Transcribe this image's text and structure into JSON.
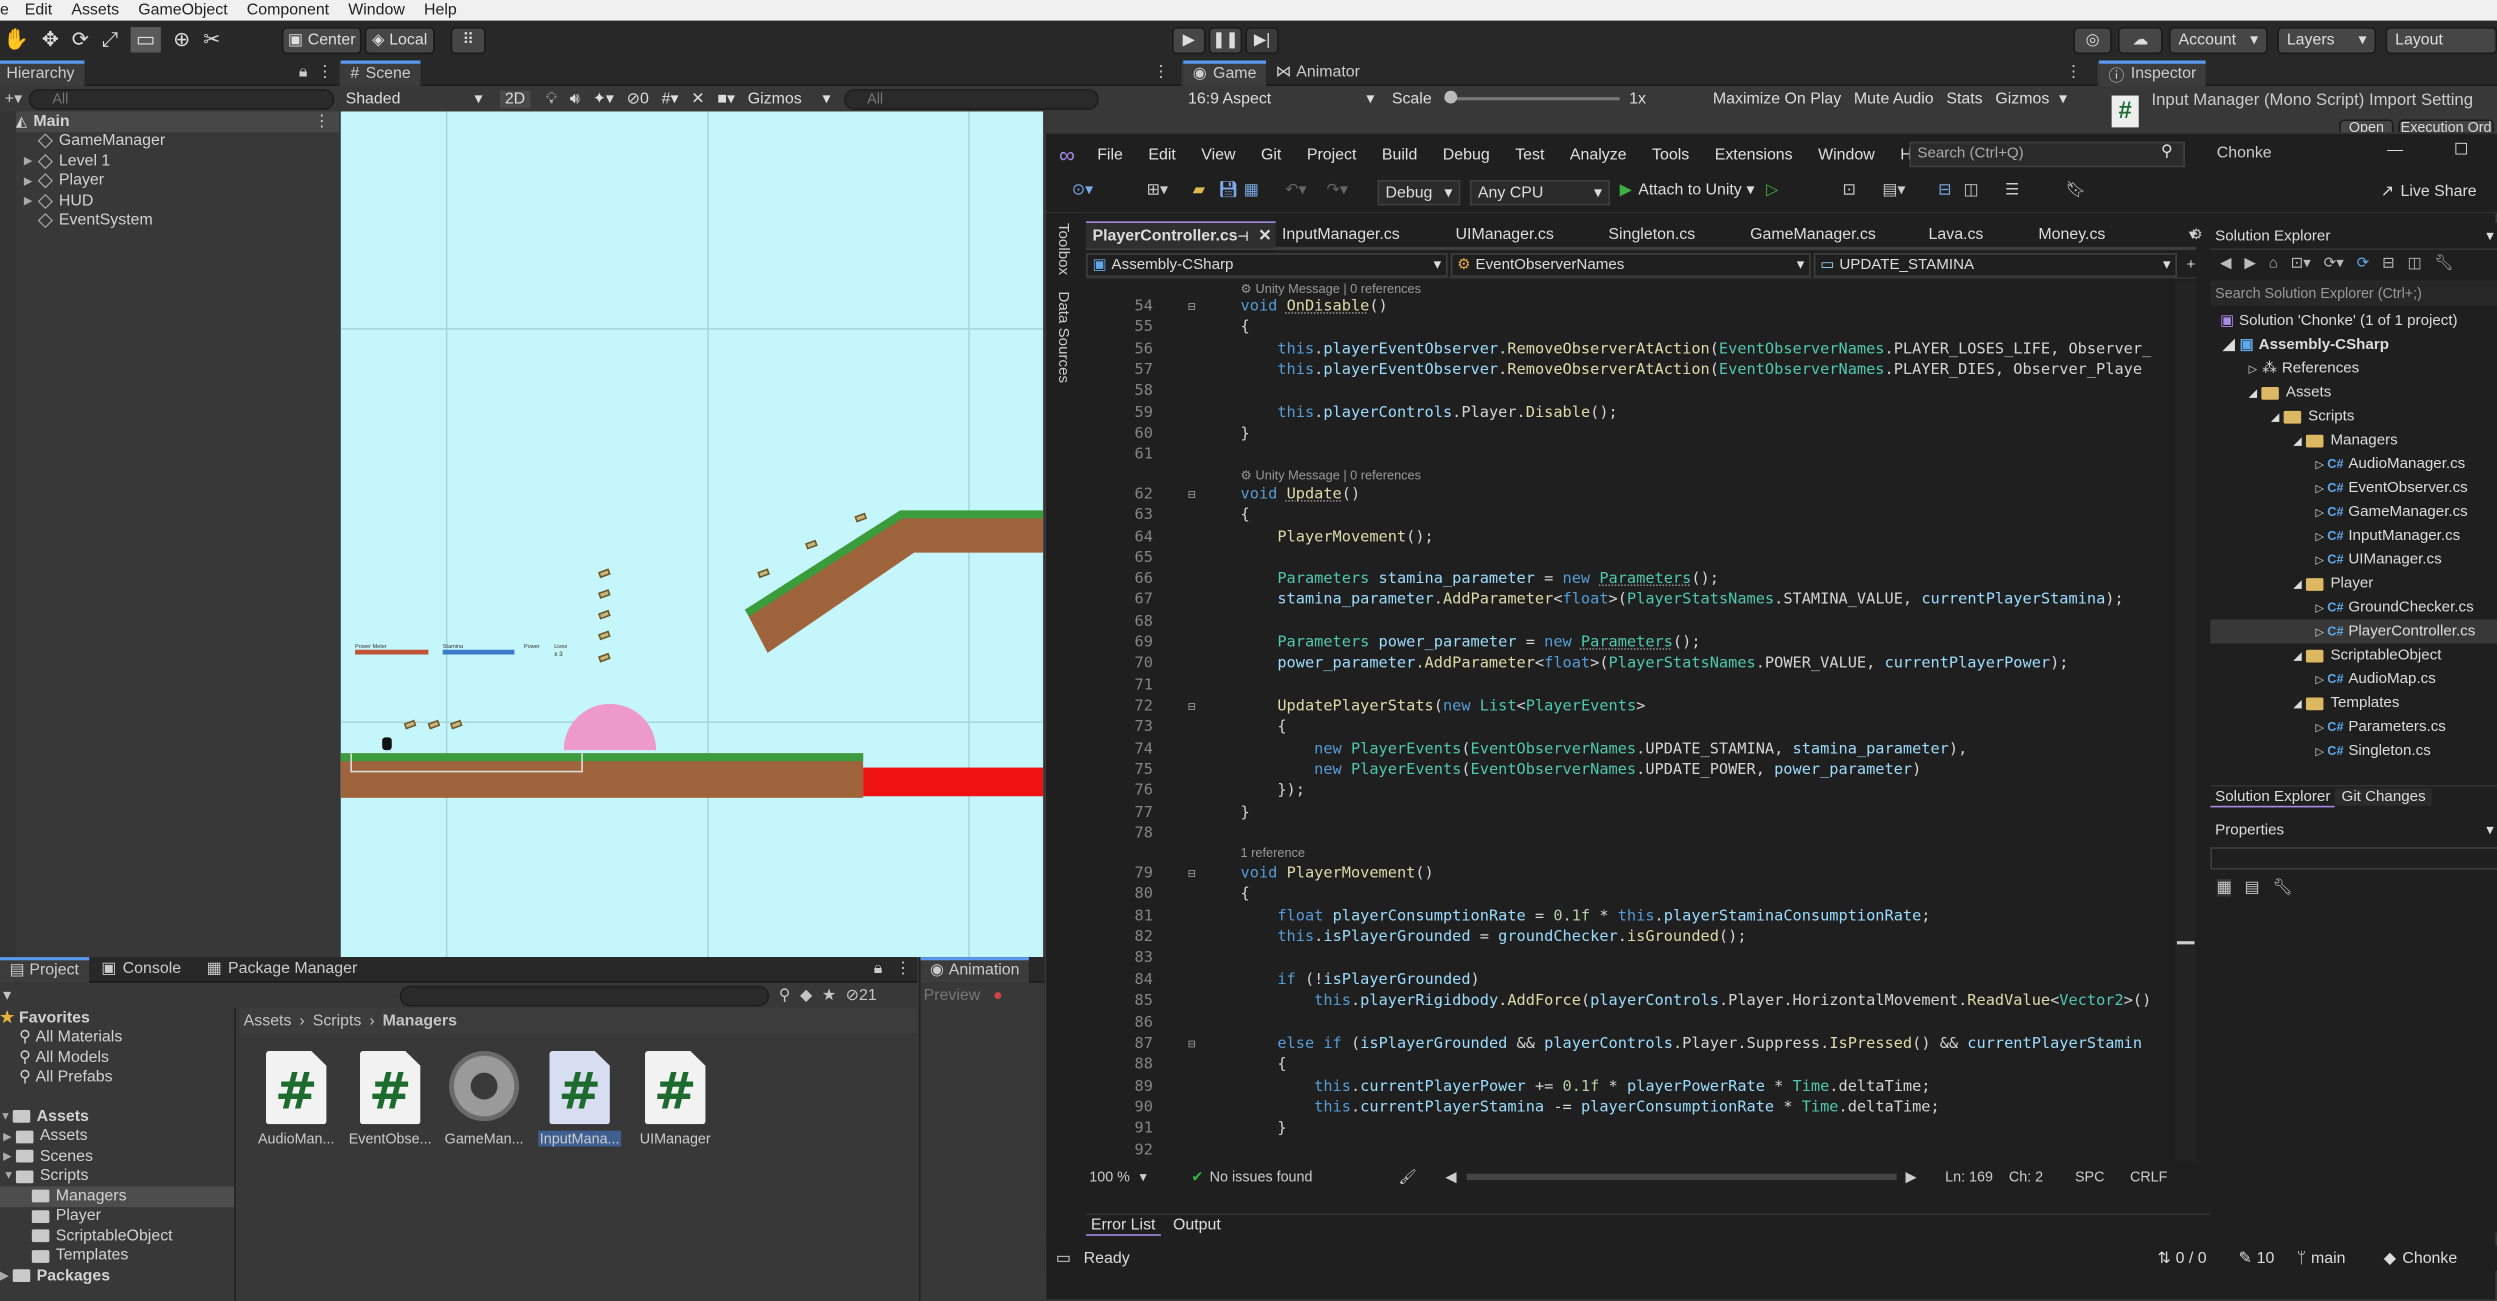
{
  "unity": {
    "menu": [
      "e",
      "Edit",
      "Assets",
      "GameObject",
      "Component",
      "Window",
      "Help"
    ],
    "toolbar": {
      "pivot": "Center",
      "space": "Local",
      "account": "Account",
      "layers": "Layers",
      "layout": "Layout"
    },
    "hierarchy": {
      "title": "Hierarchy",
      "search": "All",
      "scene": "Main",
      "items": [
        "GameManager",
        "Level 1",
        "Player",
        "HUD",
        "EventSystem"
      ]
    },
    "scene": {
      "title": "Scene",
      "shading": "Shaded",
      "mode2d": "2D",
      "hidden_count": "0",
      "gizmos": "Gizmos",
      "search": "All",
      "hud_labels": [
        "Power Meter",
        "Stamina",
        "Power",
        "Lives"
      ],
      "hud_lives": "x 3"
    },
    "game": {
      "title": "Game",
      "animator": "Animator",
      "aspect": "16:9 Aspect",
      "scale_label": "Scale",
      "scale_value": "1x",
      "buttons": [
        "Maximize On Play",
        "Mute Audio",
        "Stats",
        "Gizmos"
      ]
    },
    "inspector": {
      "title": "Inspector",
      "subject": "Input Manager (Mono Script) Import Setting",
      "btn_open": "Open",
      "btn_exec": "Execution Ord"
    },
    "bottom_tabs": [
      "Project",
      "Console",
      "Package Manager"
    ],
    "animation": {
      "title": "Animation",
      "preview": "Preview"
    },
    "hidden_packages": "21",
    "project_tree": {
      "favorites": "Favorites",
      "fav_items": [
        "All Materials",
        "All Models",
        "All Prefabs"
      ],
      "assets": "Assets",
      "asset_items": [
        "Assets",
        "Scenes",
        "Scripts"
      ],
      "script_items": [
        "Managers",
        "Player",
        "ScriptableObject",
        "Templates"
      ],
      "packages": "Packages"
    },
    "breadcrumb": [
      "Assets",
      "Scripts",
      "Managers"
    ],
    "assets": [
      {
        "name": "AudioMan...",
        "icon": "csharp-script-icon"
      },
      {
        "name": "EventObse...",
        "icon": "csharp-script-icon"
      },
      {
        "name": "GameMan...",
        "icon": "gear-icon"
      },
      {
        "name": "InputMana...",
        "icon": "csharp-script-icon"
      },
      {
        "name": "UIManager",
        "icon": "csharp-script-icon"
      }
    ]
  },
  "vs": {
    "menu": [
      "File",
      "Edit",
      "View",
      "Git",
      "Project",
      "Build",
      "Debug",
      "Test",
      "Analyze",
      "Tools",
      "Extensions",
      "Window",
      "Help"
    ],
    "search_placeholder": "Search (Ctrl+Q)",
    "config": "Debug",
    "platform": "Any CPU",
    "attach": "Attach to Unity",
    "live_share": "Live Share",
    "project_name": "Chonke",
    "side_tabs": [
      "Toolbox",
      "Data Sources"
    ],
    "tabs": [
      "PlayerController.cs",
      "InputManager.cs",
      "UIManager.cs",
      "Singleton.cs",
      "GameManager.cs",
      "Lava.cs",
      "Money.cs"
    ],
    "nav": {
      "project": "Assembly-CSharp",
      "class": "EventObserverNames",
      "member": "UPDATE_STAMINA"
    },
    "code_lens": {
      "unity_msg": "Unity Message | 0 references",
      "one_ref": "1 reference"
    },
    "status": {
      "zoom": "100 %",
      "issues": "No issues found",
      "line": "Ln: 169",
      "col": "Ch: 2",
      "spc": "SPC",
      "crlf": "CRLF"
    },
    "bottom_tabs": [
      "Error List",
      "Output"
    ],
    "statusbar": {
      "ready": "Ready",
      "changes": "0 / 0",
      "commits": "10",
      "branch": "main",
      "repo": "Chonke"
    },
    "solution": {
      "title": "Solution Explorer",
      "search": "Search Solution Explorer (Ctrl+;)",
      "nodes": [
        "Solution 'Chonke' (1 of 1 project)",
        "Assembly-CSharp",
        "References",
        "Assets",
        "Scripts",
        "Managers",
        "AudioManager.cs",
        "EventObserver.cs",
        "GameManager.cs",
        "InputManager.cs",
        "UIManager.cs",
        "Player",
        "GroundChecker.cs",
        "PlayerController.cs",
        "ScriptableObject",
        "AudioMap.cs",
        "Templates",
        "Parameters.cs",
        "Singleton.cs"
      ],
      "tabs": [
        "Solution Explorer",
        "Git Changes"
      ],
      "properties": "Properties"
    },
    "line_numbers": [
      "54",
      "55",
      "56",
      "57",
      "58",
      "59",
      "60",
      "61",
      "62",
      "63",
      "64",
      "65",
      "66",
      "67",
      "68",
      "69",
      "70",
      "71",
      "72",
      "73",
      "74",
      "75",
      "76",
      "77",
      "78",
      "79",
      "80",
      "81",
      "82",
      "83",
      "84",
      "85",
      "86",
      "87",
      "88",
      "89",
      "90",
      "91",
      "92"
    ],
    "code": {
      "l54": "void OnDisable()",
      "l55": "{",
      "l56": "this.playerEventObserver.RemoveObserverAtAction(EventObserverNames.PLAYER_LOSES_LIFE, Observer_",
      "l57": "this.playerEventObserver.RemoveObserverAtAction(EventObserverNames.PLAYER_DIES, Observer_Playe",
      "l59": "this.playerControls.Player.Disable();",
      "l60": "}",
      "l62": "void Update()",
      "l63": "{",
      "l64": "PlayerMovement();",
      "l66": "Parameters stamina_parameter = new Parameters();",
      "l67": "stamina_parameter.AddParameter<float>(PlayerStatsNames.STAMINA_VALUE, currentPlayerStamina);",
      "l69": "Parameters power_parameter = new Parameters();",
      "l70": "power_parameter.AddParameter<float>(PlayerStatsNames.POWER_VALUE, currentPlayerPower);",
      "l72": "UpdatePlayerStats(new List<PlayerEvents>",
      "l73": "{",
      "l74": "new PlayerEvents(EventObserverNames.UPDATE_STAMINA, stamina_parameter),",
      "l75": "new PlayerEvents(EventObserverNames.UPDATE_POWER, power_parameter)",
      "l76": "});",
      "l77": "}",
      "l79": "void PlayerMovement()",
      "l80": "{",
      "l81": "float playerConsumptionRate = 0.1f * this.playerStaminaConsumptionRate;",
      "l82": "this.isPlayerGrounded = groundChecker.isGrounded();",
      "l84": "if (!isPlayerGrounded)",
      "l85": "this.playerRigidbody.AddForce(playerControls.Player.HorizontalMovement.ReadValue<Vector2>()",
      "l87": "else if (isPlayerGrounded && playerControls.Player.Suppress.IsPressed() && currentPlayerStamin",
      "l88": "{",
      "l89": "this.currentPlayerPower += 0.1f * playerPowerRate * Time.deltaTime;",
      "l90": "this.currentPlayerStamina -= playerConsumptionRate * Time.deltaTime;",
      "l91": "}"
    }
  }
}
